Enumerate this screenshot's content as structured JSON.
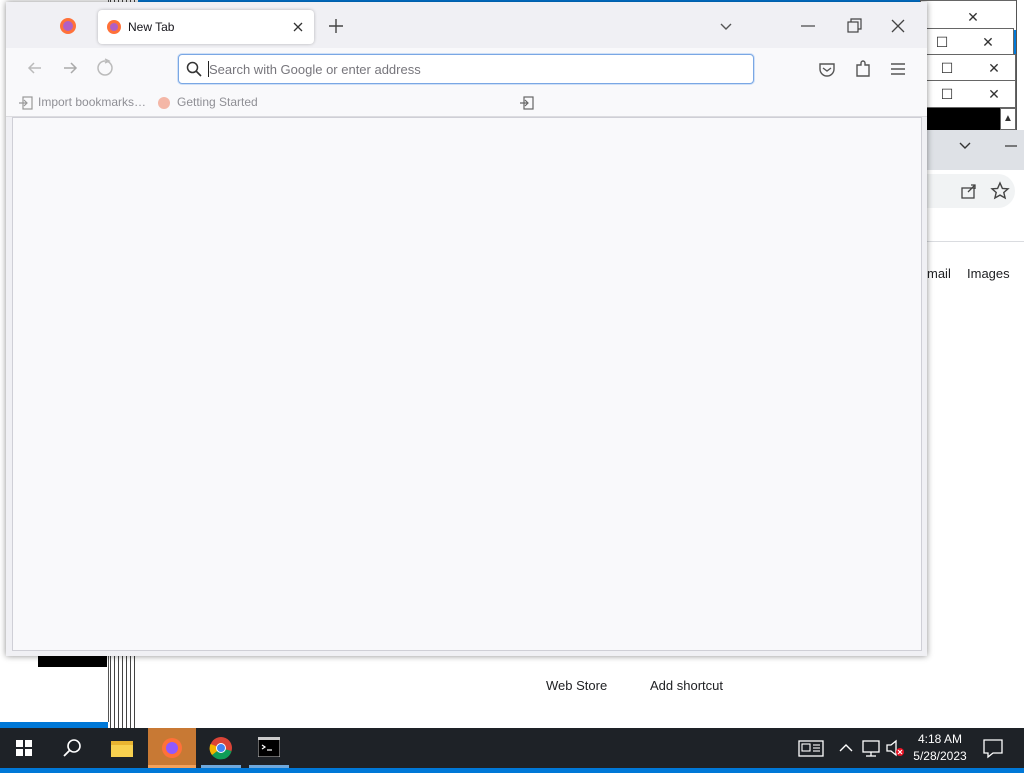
{
  "background": {
    "color": "#0078d7",
    "chrome_window": {
      "links": [
        "mail",
        "Images"
      ],
      "shortcuts": [
        "Web Store",
        "Add shortcut"
      ]
    }
  },
  "firefox": {
    "tab": {
      "title": "New Tab"
    },
    "urlbar": {
      "placeholder": "Search with Google or enter address",
      "value": ""
    },
    "bookmarks": [
      {
        "label": "Import bookmarks…",
        "icon": "import-icon"
      },
      {
        "label": "Getting Started",
        "icon": "firefox-logo-icon"
      }
    ],
    "accent_color": "#7aa7e4"
  },
  "taskbar": {
    "apps": [
      {
        "name": "File Explorer",
        "icon": "folder-icon",
        "active": false
      },
      {
        "name": "Firefox",
        "icon": "firefox-icon",
        "active": true
      },
      {
        "name": "Chrome",
        "icon": "chrome-icon",
        "active": false
      },
      {
        "name": "Command Prompt",
        "icon": "terminal-icon",
        "active": false
      }
    ],
    "clock": {
      "time": "4:18 AM",
      "date": "5/28/2023"
    }
  }
}
